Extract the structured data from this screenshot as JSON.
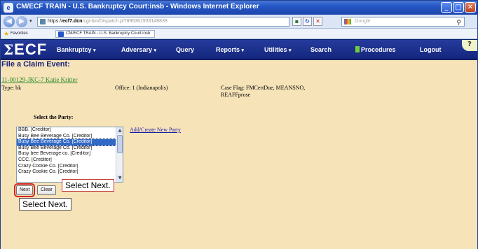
{
  "window": {
    "title": "CM/ECF TRAIN - U.S. Bankruptcy Court:insb - Windows Internet Explorer",
    "app_icon": "e",
    "buttons": {
      "minimize": "_",
      "maximize": "□",
      "close": "✕"
    }
  },
  "address_bar": {
    "url_scheme": "https://",
    "url_host": "ecf7.dcn",
    "url_rest": "/cgi-bin/Dispatch.pl?896361933148839",
    "search_placeholder": "Google",
    "back_glyph": "◀",
    "forward_glyph": "▶",
    "menu_glyph": "▾",
    "search_go_glyph": "⚲"
  },
  "favorites_bar": {
    "label": "Favorites",
    "tab": "CM/ECF TRAIN - U.S. Bankruptcy Court:insb",
    "star_glyph": "★"
  },
  "ecf_nav": {
    "logo": "ECF",
    "logo_symbol": "Σ",
    "items": [
      {
        "label": "Bankruptcy"
      },
      {
        "label": "Adversary"
      },
      {
        "label": "Query"
      },
      {
        "label": "Reports"
      },
      {
        "label": "Utilities"
      },
      {
        "label": "Search"
      },
      {
        "label": "Procedures"
      },
      {
        "label": "Logout"
      }
    ],
    "caret": "▾",
    "help_glyph": "?"
  },
  "page": {
    "title": "File a Claim Event:",
    "case_link": "11-00129-JKC-7 Katie Kritter",
    "type": "Type: bk",
    "office": "Office: 1 (Indianapolis)",
    "case_flags": "Case Flag: FMCertDue, MEANSNO, REAFFprose",
    "select_label": "Select the Party:",
    "add_party_link": "Add/Create New Party",
    "parties": [
      "BBB. [Creditor]",
      "Busy Bee Beverage Co. [Creditor]",
      "Busy Bee Beverage Co. [Creditor]",
      "Busy Bee Beverage Co. [Creditor]",
      "Busy bee Beverage co. [Creditor]",
      "CCC. [Creditor]",
      "Crazy Cookie Co. [Creditor]",
      "Crazy Cookie Co. [Creditor]"
    ],
    "selected_party_index": 2,
    "buttons": {
      "next": "Next",
      "clear": "Clear"
    },
    "callouts": [
      "Select Next.",
      "Select Next."
    ]
  }
}
